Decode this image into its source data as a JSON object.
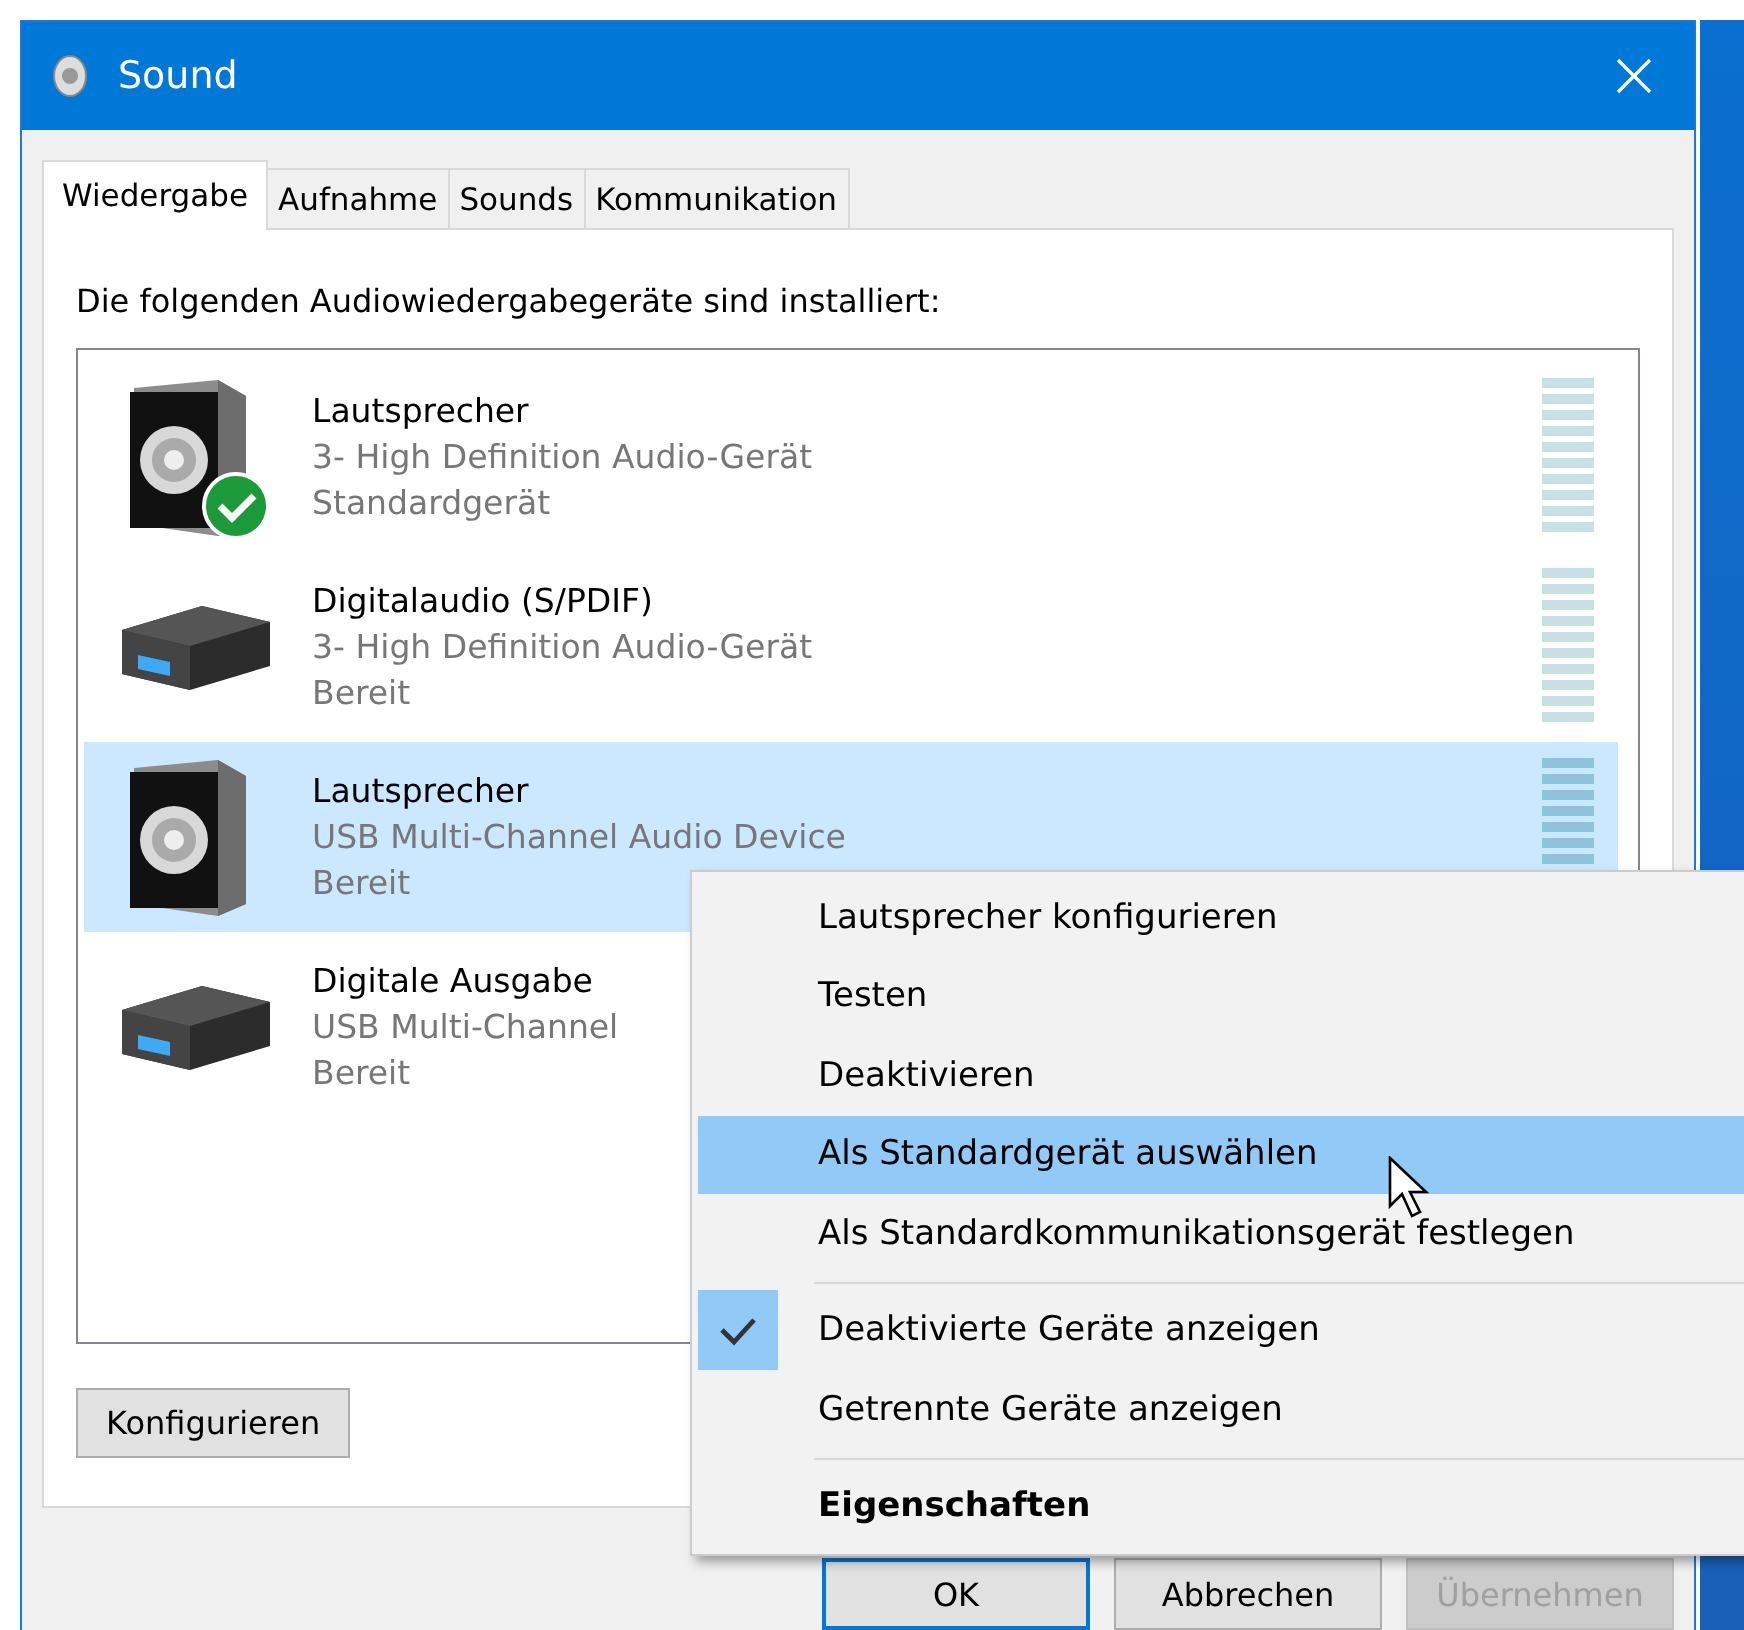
{
  "window": {
    "title": "Sound"
  },
  "tabs": [
    {
      "label": "Wiedergabe",
      "selected": true
    },
    {
      "label": "Aufnahme",
      "selected": false
    },
    {
      "label": "Sounds",
      "selected": false
    },
    {
      "label": "Kommunikation",
      "selected": false
    }
  ],
  "heading": "Die folgenden Audiowiedergabegeräte sind installiert:",
  "devices": [
    {
      "kind": "speaker",
      "name": "Lautsprecher",
      "driver": "3- High Definition Audio-Gerät",
      "status": "Standardgerät",
      "default": true,
      "selected": false
    },
    {
      "kind": "digital",
      "name": "Digitalaudio (S/PDIF)",
      "driver": "3- High Definition Audio-Gerät",
      "status": "Bereit",
      "default": false,
      "selected": false
    },
    {
      "kind": "speaker",
      "name": "Lautsprecher",
      "driver": "USB Multi-Channel Audio Device",
      "status": "Bereit",
      "default": false,
      "selected": true
    },
    {
      "kind": "digital",
      "name": "Digitale Ausgabe",
      "driver": "USB Multi-Channel",
      "status": "Bereit",
      "default": false,
      "selected": false
    }
  ],
  "configure_button": "Konfigurieren",
  "buttons": [
    {
      "label": "OK",
      "default": true,
      "disabled": false
    },
    {
      "label": "Abbrechen",
      "default": false,
      "disabled": false
    },
    {
      "label": "Übernehmen",
      "default": false,
      "disabled": true
    }
  ],
  "context_menu": {
    "groups": [
      {
        "items": [
          {
            "label": "Lautsprecher konfigurieren",
            "selected": false,
            "checked": false,
            "default": false
          },
          {
            "label": "Testen",
            "selected": false,
            "checked": false,
            "default": false
          },
          {
            "label": "Deaktivieren",
            "selected": false,
            "checked": false,
            "default": false
          },
          {
            "label": "Als Standardgerät auswählen",
            "selected": true,
            "checked": false,
            "default": false
          },
          {
            "label": "Als Standardkommunikationsgerät festlegen",
            "selected": false,
            "checked": false,
            "default": false
          }
        ]
      },
      {
        "items": [
          {
            "label": "Deaktivierte Geräte anzeigen",
            "selected": false,
            "checked": true,
            "default": false
          },
          {
            "label": "Getrennte Geräte anzeigen",
            "selected": false,
            "checked": false,
            "default": false
          }
        ]
      },
      {
        "items": [
          {
            "label": "Eigenschaften",
            "selected": false,
            "checked": false,
            "default": true
          }
        ]
      }
    ]
  }
}
